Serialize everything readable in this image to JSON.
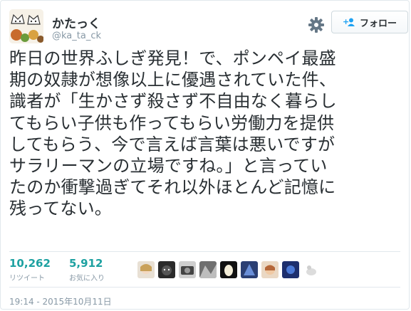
{
  "user": {
    "display_name": "かたっく",
    "screen_name": "@ka_ta_ck"
  },
  "actions": {
    "settings_icon": "gear-icon",
    "follow_label": "フォロー"
  },
  "tweet": {
    "lines": [
      "昨日の世界ふしぎ発見！で、ポンペイ最盛",
      "期の奴隷が想像以上に優遇されていた件、",
      "識者が「生かさず殺さず不自由なく暮らし",
      "てもらい子供も作ってもらい労働力を提供",
      "してもらう、今で言えば言葉は悪いですが",
      "サラリーマンの立場ですね。」と言ってい",
      "たのか衝撃過ぎてそれ以外ほとんど記憶に",
      "残ってない。"
    ]
  },
  "stats": {
    "retweets_count": "10,262",
    "retweets_label": "リツイート",
    "favorites_count": "5,912",
    "favorites_label": "お気に入り"
  },
  "timestamp": "19:14 - 2015年10月11日",
  "colors": {
    "accent": "#1da1a1",
    "muted": "#8899a6",
    "text": "#292f33",
    "border": "#e1e8ed"
  }
}
